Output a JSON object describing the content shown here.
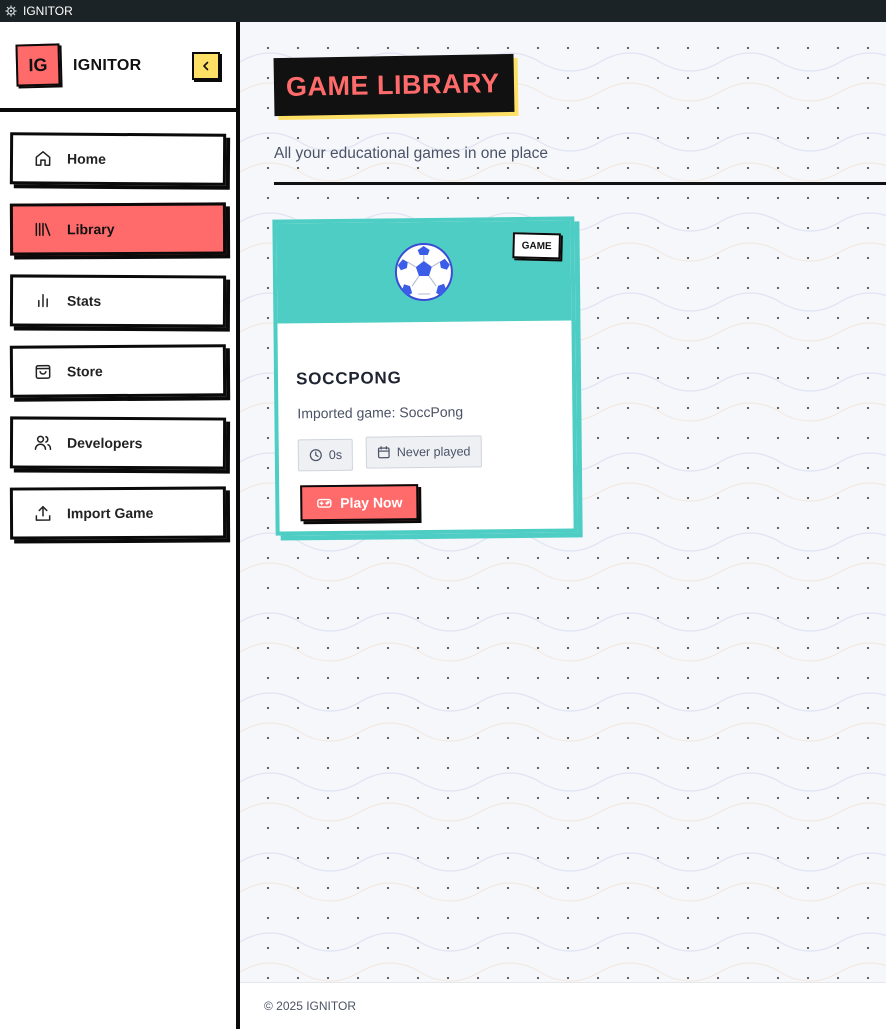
{
  "window": {
    "title": "IGNITOR",
    "icon": "gear-app-icon"
  },
  "sidebar": {
    "logo_text": "IG",
    "brand": "IGNITOR",
    "collapse_icon": "chevron-left-icon",
    "items": [
      {
        "label": "Home",
        "icon": "home-icon",
        "active": false
      },
      {
        "label": "Library",
        "icon": "library-icon",
        "active": true
      },
      {
        "label": "Stats",
        "icon": "bar-chart-icon",
        "active": false
      },
      {
        "label": "Store",
        "icon": "shopping-bag-icon",
        "active": false
      },
      {
        "label": "Developers",
        "icon": "users-icon",
        "active": false
      },
      {
        "label": "Import Game",
        "icon": "upload-icon",
        "active": false
      }
    ]
  },
  "main": {
    "title": "GAME LIBRARY",
    "subtitle": "All your educational games in one place",
    "games": [
      {
        "badge": "GAME",
        "cover_icon": "soccer-ball-icon",
        "title": "SOCCPONG",
        "description": "Imported game: SoccPong",
        "playtime": "0s",
        "last_played": "Never played",
        "play_label": "Play Now"
      }
    ]
  },
  "footer": {
    "text": "© 2025 IGNITOR"
  },
  "colors": {
    "accent_red": "#ff6b6b",
    "accent_teal": "#4ecdc4",
    "accent_yellow": "#ffe066",
    "ink": "#0a0a0a"
  }
}
